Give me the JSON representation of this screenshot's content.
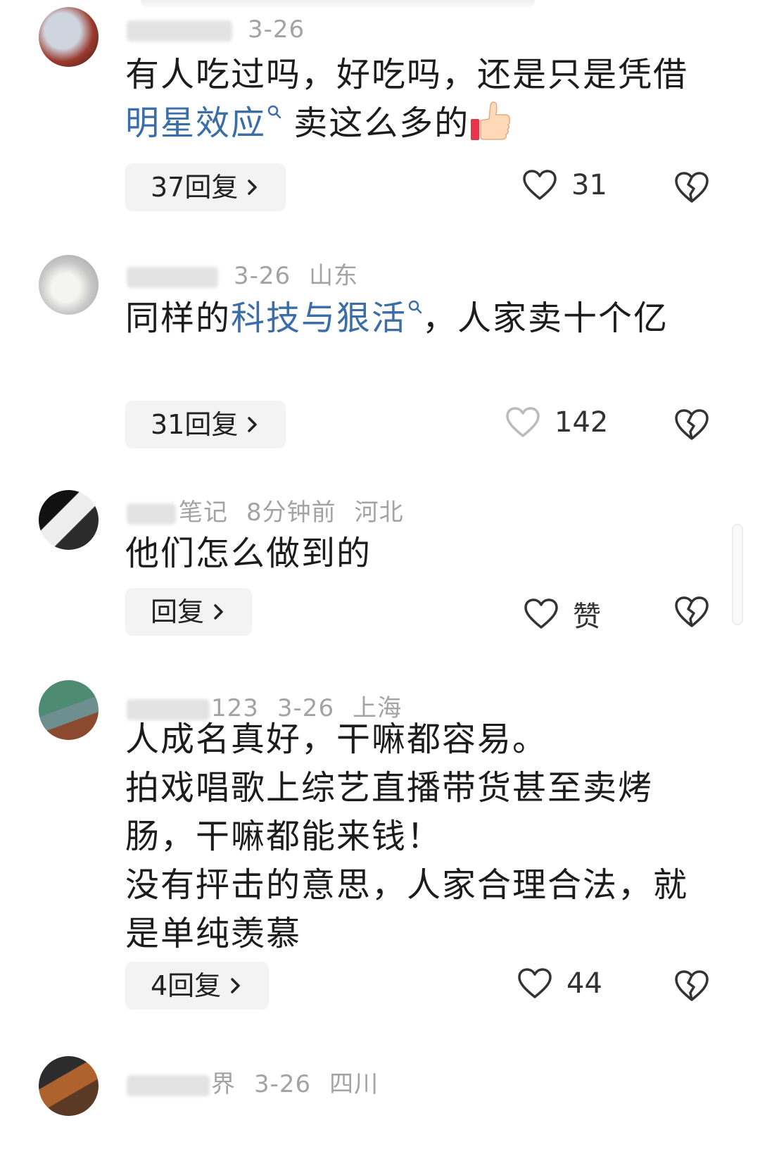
{
  "comments": [
    {
      "meta_blur": "",
      "date": "3-26",
      "location": "",
      "text_parts": [
        "有人吃过吗，好吃吗，还是只是凭借",
        "明星效应",
        " 卖这么多的"
      ],
      "reply_label": "37回复",
      "like_count": "31"
    },
    {
      "meta_blur": "",
      "date": "3-26",
      "location": "山东",
      "text_parts": [
        "同样的",
        "科技与狠活",
        "，人家卖十个亿"
      ],
      "reply_label": "31回复",
      "like_count": "142"
    },
    {
      "meta_blur": "",
      "name_suffix": "笔记",
      "date": "8分钟前",
      "location": "河北",
      "text": "他们怎么做到的",
      "reply_label": "回复",
      "like_count": "赞"
    },
    {
      "meta_blur": "",
      "name_suffix": "123",
      "date": "3-26",
      "location": "上海",
      "text_lines": [
        "人成名真好，干嘛都容易。",
        "拍戏唱歌上综艺直播带货甚至卖烤肠，干嘛都能来钱！",
        "没有抨击的意思，人家合理合法，就是单纯羡慕"
      ],
      "reply_label": "4回复",
      "like_count": "44"
    },
    {
      "meta_blur": "",
      "name_suffix": "界",
      "date": "3-26",
      "location": "四川"
    }
  ],
  "icons": {
    "like": "heart-outline-icon",
    "dislike": "broken-heart-icon",
    "reply_chevron": "chevron-right-icon",
    "search_link": "search-icon",
    "emoji": "thumbs-up-emoji"
  },
  "colors": {
    "link": "#3b6ea9",
    "meta": "#a3a3a3",
    "reply_bg": "#f3f3f3"
  }
}
